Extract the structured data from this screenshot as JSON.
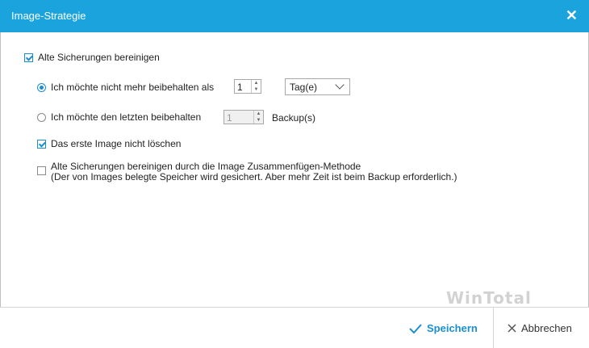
{
  "window": {
    "title": "Image-Strategie",
    "close_label": "✕"
  },
  "options": {
    "cleanup_label": "Alte Sicherungen bereinigen",
    "cleanup_checked": true,
    "radio_days_label": "Ich möchte nicht mehr beibehalten als",
    "days_value": "1",
    "days_unit": "Tag(e)",
    "radio_keep_label": "Ich möchte den letzten beibehalten",
    "keep_value": "1",
    "keep_suffix": "Backup(s)",
    "no_delete_first_label": "Das erste Image nicht löschen",
    "merge_label_line1": "Alte Sicherungen bereinigen durch die Image Zusammenfügen-Methode",
    "merge_label_line2": "(Der von Images belegte Speicher wird gesichert. Aber mehr Zeit ist beim Backup erforderlich.)"
  },
  "footer": {
    "save_label": "Speichern",
    "cancel_label": "Abbrechen"
  },
  "watermark": "WinTotal",
  "colors": {
    "accent": "#1aa3dc",
    "check": "#1a8fcf"
  }
}
